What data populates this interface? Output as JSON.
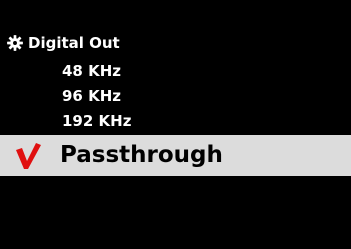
{
  "menu": {
    "title": "Digital Out",
    "title_icon": "gear-icon",
    "options": [
      {
        "label": "48 KHz"
      },
      {
        "label": "96 KHz"
      },
      {
        "label": "192 KHz"
      }
    ],
    "selected": {
      "label": "Passthrough",
      "check_icon": "checkmark-icon"
    }
  },
  "colors": {
    "background": "#000000",
    "text": "#ffffff",
    "selected_bg": "#dcdcdc",
    "selected_text": "#000000",
    "check": "#e01010"
  }
}
